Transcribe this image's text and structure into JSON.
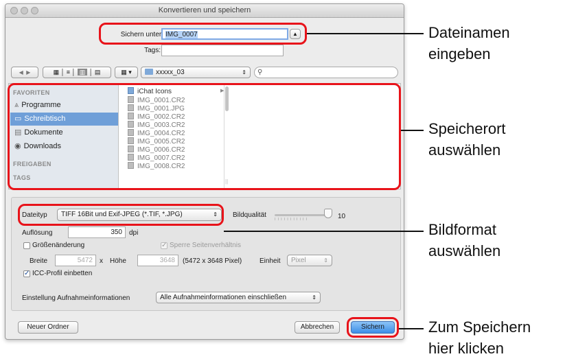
{
  "window": {
    "title": "Konvertieren und speichern"
  },
  "save": {
    "save_as_label": "Sichern unter:",
    "filename": "IMG_0007",
    "tags_label": "Tags:",
    "tags_value": ""
  },
  "toolbar": {
    "folder": "xxxxx_03",
    "search_value": ""
  },
  "sidebar": {
    "favorites_header": "FAVORITEN",
    "items": [
      {
        "label": "Programme",
        "icon": "applications-icon"
      },
      {
        "label": "Schreibtisch",
        "icon": "desktop-icon"
      },
      {
        "label": "Dokumente",
        "icon": "documents-icon"
      },
      {
        "label": "Downloads",
        "icon": "downloads-icon"
      }
    ],
    "shared_header": "FREIGABEN",
    "tags_header": "TAGS"
  },
  "files": [
    "iChat Icons",
    "IMG_0001.CR2",
    "IMG_0001.JPG",
    "IMG_0002.CR2",
    "IMG_0003.CR2",
    "IMG_0004.CR2",
    "IMG_0005.CR2",
    "IMG_0006.CR2",
    "IMG_0007.CR2",
    "IMG_0008.CR2"
  ],
  "options": {
    "filetype_label": "Dateityp",
    "filetype_value": "TIFF 16Bit und Exif-JPEG (*.TIF, *.JPG)",
    "quality_label": "Bildqualität",
    "quality_value": "10",
    "resolution_label": "Auflösung",
    "resolution_value": "350",
    "resolution_unit": "dpi",
    "resize_label": "Größenänderung",
    "aspect_label": "Sperre Seitenverhältnis",
    "width_label": "Breite",
    "width_value": "5472",
    "times": "x",
    "height_label": "Höhe",
    "height_value": "3648",
    "pixel_info": "(5472 x 3648 Pixel)",
    "unit_label": "Einheit",
    "unit_value": "Pixel",
    "icc_label": "ICC-Profil einbetten",
    "shooting_info_label": "Einstellung Aufnahmeinformationen",
    "shooting_info_value": "Alle Aufnahmeinformationen einschließen"
  },
  "buttons": {
    "new_folder": "Neuer Ordner",
    "cancel": "Abbrechen",
    "save": "Sichern"
  },
  "callouts": {
    "filename_line1": "Dateinamen",
    "filename_line2": "eingeben",
    "location_line1": "Speicherort",
    "location_line2": "auswählen",
    "format_line1": "Bildformat",
    "format_line2": "auswählen",
    "save_line1": "Zum Speichern",
    "save_line2": "hier klicken"
  },
  "colors": {
    "highlight_red": "#e8131a",
    "selection_blue": "#6f9fd8",
    "default_button_blue": "#3d8ee6"
  }
}
